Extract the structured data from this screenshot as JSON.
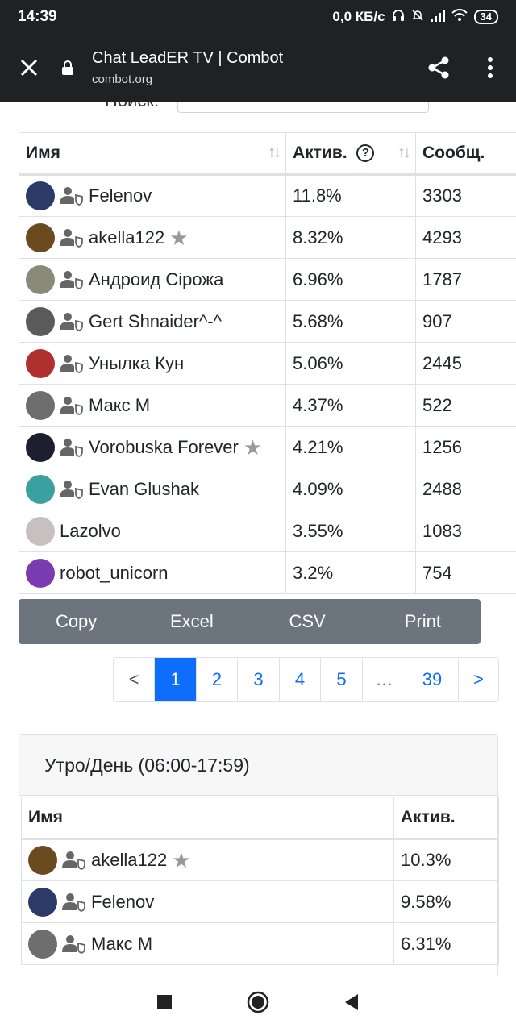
{
  "status_bar": {
    "time": "14:39",
    "network_speed": "0,0 КБ/с",
    "battery": "34"
  },
  "browser": {
    "title": "Chat LeadER TV | Combot",
    "url": "combot.org"
  },
  "search": {
    "label": "Поиск:",
    "value": ""
  },
  "main_table": {
    "columns": [
      "Имя",
      "Актив.",
      "Сообщ."
    ],
    "rows": [
      {
        "name": "Felenov",
        "activity": "11.8%",
        "messages": "3303",
        "avatar_color": "#2b3a67",
        "role_icon": true,
        "star": false
      },
      {
        "name": "akella122",
        "activity": "8.32%",
        "messages": "4293",
        "avatar_color": "#6b4a1f",
        "role_icon": true,
        "star": true
      },
      {
        "name": "Андроид Сірожа",
        "activity": "6.96%",
        "messages": "1787",
        "avatar_color": "#8a8a7a",
        "role_icon": true,
        "star": false
      },
      {
        "name": "Gert Shnaider^-^",
        "activity": "5.68%",
        "messages": "907",
        "avatar_color": "#5a5a5a",
        "role_icon": true,
        "star": false
      },
      {
        "name": "Унылка Кун",
        "activity": "5.06%",
        "messages": "2445",
        "avatar_color": "#b03030",
        "role_icon": true,
        "star": false
      },
      {
        "name": "Макс М",
        "activity": "4.37%",
        "messages": "522",
        "avatar_color": "#6e6e6e",
        "role_icon": true,
        "star": false
      },
      {
        "name": "Vorobuska Forever",
        "activity": "4.21%",
        "messages": "1256",
        "avatar_color": "#1e1e2e",
        "role_icon": true,
        "star": true
      },
      {
        "name": "Evan Glushak",
        "activity": "4.09%",
        "messages": "2488",
        "avatar_color": "#3aa0a0",
        "role_icon": true,
        "star": false
      },
      {
        "name": "Lazolvo",
        "activity": "3.55%",
        "messages": "1083",
        "avatar_color": "#c8c0c0",
        "role_icon": false,
        "star": false
      },
      {
        "name": "robot_unicorn",
        "activity": "3.2%",
        "messages": "754",
        "avatar_color": "#7a3ab0",
        "role_icon": false,
        "star": false
      }
    ]
  },
  "export_buttons": [
    "Copy",
    "Excel",
    "CSV",
    "Print"
  ],
  "pagination": {
    "items": [
      "<",
      "1",
      "2",
      "3",
      "4",
      "5",
      "…",
      "39",
      ">"
    ],
    "active": "1"
  },
  "period_card": {
    "title": "Утро/День (06:00-17:59)",
    "columns": [
      "Имя",
      "Актив."
    ],
    "rows": [
      {
        "name": "akella122",
        "activity": "10.3%",
        "avatar_color": "#6b4a1f",
        "star": true
      },
      {
        "name": "Felenov",
        "activity": "9.58%",
        "avatar_color": "#2b3a67",
        "star": false
      },
      {
        "name": "Макс М",
        "activity": "6.31%",
        "avatar_color": "#6e6e6e",
        "star": false
      }
    ]
  },
  "colors": {
    "header_bg": "#202124",
    "primary": "#0d6efd",
    "export_bg": "#6c757d"
  }
}
